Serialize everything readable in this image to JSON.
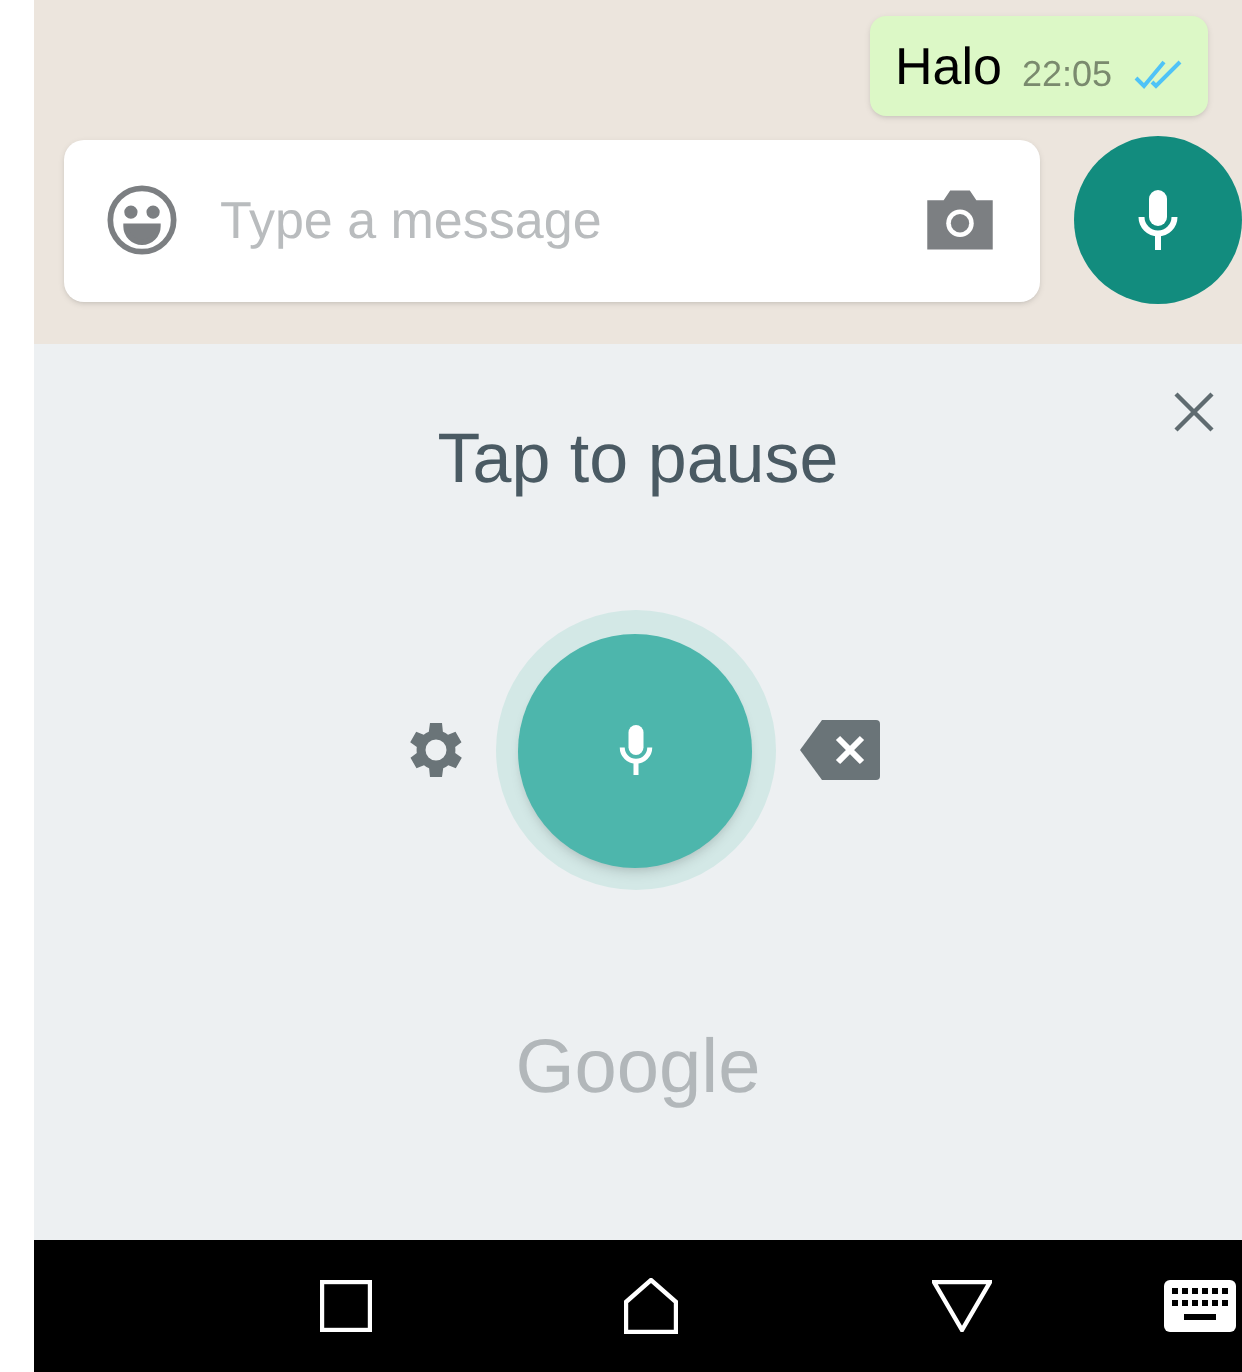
{
  "message": {
    "text": "Halo",
    "time": "22:05",
    "read": true
  },
  "composer": {
    "placeholder": "Type a message"
  },
  "voice_panel": {
    "status": "Tap to pause",
    "listening": true,
    "brand": "Google"
  }
}
